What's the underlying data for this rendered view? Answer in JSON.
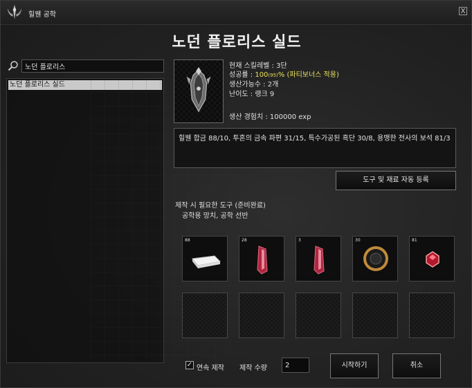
{
  "window": {
    "title": "힐웬 공학",
    "close_label": "X"
  },
  "item": {
    "name": "노던 플로리스 실드"
  },
  "search": {
    "value": "노던 플로리스"
  },
  "recipes": [
    {
      "label": "노던 플로리스 실드"
    }
  ],
  "info": {
    "skill_level": "현재 스킬레벨 : 3단",
    "success_prefix": "성공률 : ",
    "success_value": "100",
    "success_small": "(95)",
    "success_suffix": "% (파티보너스 적용)",
    "producible": "생산가능수 : 2개",
    "difficulty": "난이도 : 랭크 9",
    "exp": "생산 경험치 : 100000 exp"
  },
  "materials_text": "힐웬 합금 88/10, 투혼의 금속 파편 31/15, 특수가공된 흑단 30/8, 용맹한 전사의 보석 81/3",
  "auto_register_label": "도구 및 재료 자동 등록",
  "tools": {
    "label": "제작 시 필요한 도구 (준비완료)",
    "list": "공학용 망치, 공학 선반"
  },
  "material_slots": [
    {
      "count": "88",
      "icon": "alloy-ingot-icon"
    },
    {
      "count": "28",
      "icon": "metal-shard-icon"
    },
    {
      "count": "3",
      "icon": "metal-shard-icon"
    },
    {
      "count": "30",
      "icon": "ebony-disc-icon"
    },
    {
      "count": "81",
      "icon": "red-gem-icon"
    }
  ],
  "continuous_label": "연속 제작",
  "continuous_checked": true,
  "quantity_label": "제작 수량",
  "quantity_value": "2",
  "start_label": "시작하기",
  "cancel_label": "취소",
  "colors": {
    "highlight": "#e8e05a",
    "selected_row": "#c9c9c9"
  }
}
